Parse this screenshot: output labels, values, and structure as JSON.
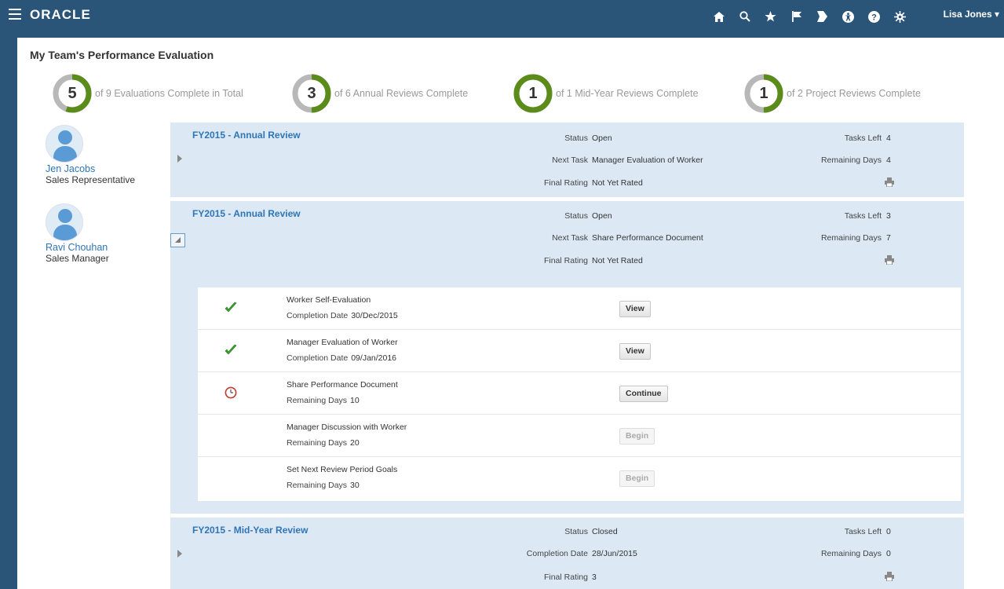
{
  "header": {
    "logo": "ORACLE",
    "icons": [
      "home-icon",
      "search-icon",
      "star-icon",
      "flag-icon",
      "tag-icon",
      "accessibility-icon",
      "help-icon",
      "settings-icon"
    ],
    "user": "Lisa Jones ▾"
  },
  "page": {
    "title": "My Team's Performance Evaluation"
  },
  "summary": [
    {
      "count": "5",
      "text": "of 9 Evaluations Complete in Total",
      "fraction": 0.5556
    },
    {
      "count": "3",
      "text": "of 6 Annual Reviews Complete",
      "fraction": 0.5
    },
    {
      "count": "1",
      "text": "of 1 Mid-Year Reviews Complete",
      "fraction": 1.0
    },
    {
      "count": "1",
      "text": "of 2 Project Reviews Complete",
      "fraction": 0.5
    }
  ],
  "colors": {
    "progress": "#5b8c1b",
    "track": "#b8b8b8",
    "link": "#2f75b5",
    "header": "#2b5578",
    "card": "#dce9f5"
  },
  "people": [
    {
      "name": "Jen Jacobs",
      "role": "Sales Representative"
    },
    {
      "name": "Ravi Chouhan",
      "role": "Sales Manager"
    }
  ],
  "reviews": [
    {
      "title": "FY2015 - Annual Review",
      "status_label": "Status",
      "status": "Open",
      "task_label": "Next Task",
      "task": "Manager Evaluation of Worker",
      "rating_label": "Final Rating",
      "rating": "Not Yet Rated",
      "tasks_left_label": "Tasks Left",
      "tasks_left": "4",
      "days_label": "Remaining Days",
      "days": "4"
    },
    {
      "title": "FY2015 - Annual Review",
      "status_label": "Status",
      "status": "Open",
      "task_label": "Next Task",
      "task": "Share Performance Document",
      "rating_label": "Final Rating",
      "rating": "Not Yet Rated",
      "tasks_left_label": "Tasks Left",
      "tasks_left": "3",
      "days_label": "Remaining Days",
      "days": "7",
      "tasks": [
        {
          "name": "Worker Self-Evaluation",
          "meta_label": "Completion Date",
          "meta": "30/Dec/2015",
          "button": "View",
          "state": "done"
        },
        {
          "name": "Manager Evaluation of Worker",
          "meta_label": "Completion Date",
          "meta": "09/Jan/2016",
          "button": "View",
          "state": "done"
        },
        {
          "name": "Share Performance Document",
          "meta_label": "Remaining Days",
          "meta": "10",
          "button": "Continue",
          "state": "current"
        },
        {
          "name": "Manager Discussion with Worker",
          "meta_label": "Remaining Days",
          "meta": "20",
          "button": "Begin",
          "state": "pending"
        },
        {
          "name": "Set Next Review Period Goals",
          "meta_label": "Remaining Days",
          "meta": "30",
          "button": "Begin",
          "state": "pending"
        }
      ]
    },
    {
      "title": "FY2015 - Mid-Year Review",
      "status_label": "Status",
      "status": "Closed",
      "task_label": "Completion Date",
      "task": "28/Jun/2015",
      "rating_label": "Final Rating",
      "rating": "3",
      "tasks_left_label": "Tasks Left",
      "tasks_left": "0",
      "days_label": "Remaining Days",
      "days": "0"
    }
  ]
}
